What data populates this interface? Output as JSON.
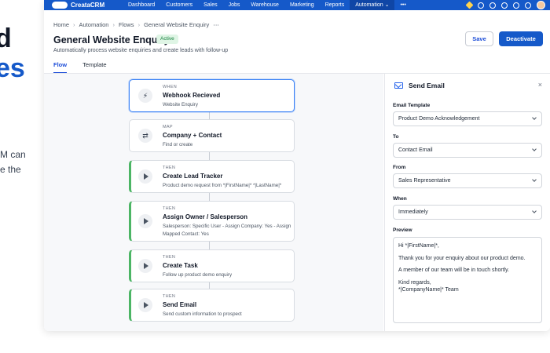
{
  "hero": {
    "line1": "d",
    "line2": "es",
    "line3": "M can",
    "line4": "e the",
    "accent_color": "#1559c9"
  },
  "topbar": {
    "brand": "CreataCRM",
    "nav": [
      "Dashboard",
      "Customers",
      "Sales",
      "Jobs",
      "Warehouse",
      "Marketing",
      "Reports",
      "Automation",
      "•••"
    ],
    "active": "Automation",
    "icons": [
      "warning-icon",
      "add-icon",
      "search-icon",
      "bell-icon",
      "help-icon",
      "settings-icon",
      "avatar"
    ]
  },
  "breadcrumb": [
    "Home",
    "Automation",
    "Flows",
    "General Website Enquiry"
  ],
  "page": {
    "title": "General Website Enquiry",
    "status": "Active",
    "subtitle": "Automatically process website enquiries and create leads with follow-up",
    "save_label": "Save",
    "deactivate_label": "Deactivate"
  },
  "tabs": [
    "Flow",
    "Template"
  ],
  "flow": [
    {
      "kind": "WHEN",
      "title": "Webhook Recieved",
      "desc": "Website Enquiry",
      "icon": "lightning-icon"
    },
    {
      "kind": "MAP",
      "title": "Company + Contact",
      "desc": "Find or create",
      "icon": "swap-icon"
    },
    {
      "kind": "THEN",
      "title": "Create Lead Tracker",
      "desc": "Product demo request from *|FirstName|* *|LastName|*",
      "icon": "play-icon"
    },
    {
      "kind": "THEN",
      "title": "Assign Owner / Salesperson",
      "desc": "Salesperson: Specific User - Assign Company: Yes - Assign Mapped Contact: Yes",
      "icon": "play-icon"
    },
    {
      "kind": "THEN",
      "title": "Create Task",
      "desc": "Follow up product demo enquiry",
      "icon": "play-icon"
    },
    {
      "kind": "THEN",
      "title": "Send Email",
      "desc": "Send custom information to prospect",
      "icon": "play-icon"
    }
  ],
  "panel": {
    "title": "Send Email",
    "close": "×",
    "fields": [
      {
        "label": "Email Template",
        "value": "Product Demo Acknowledgement"
      },
      {
        "label": "To",
        "value": "Contact Email"
      },
      {
        "label": "From",
        "value": "Sales Representative"
      },
      {
        "label": "When",
        "value": "Immediately"
      }
    ],
    "preview_label": "Preview",
    "preview": [
      "Hi *|FirstName|*,",
      "Thank you for your enquiry about our product demo.",
      "A member of our team will be in touch shortly.",
      "Kind regards,\n*|CompanyName|* Team"
    ]
  }
}
